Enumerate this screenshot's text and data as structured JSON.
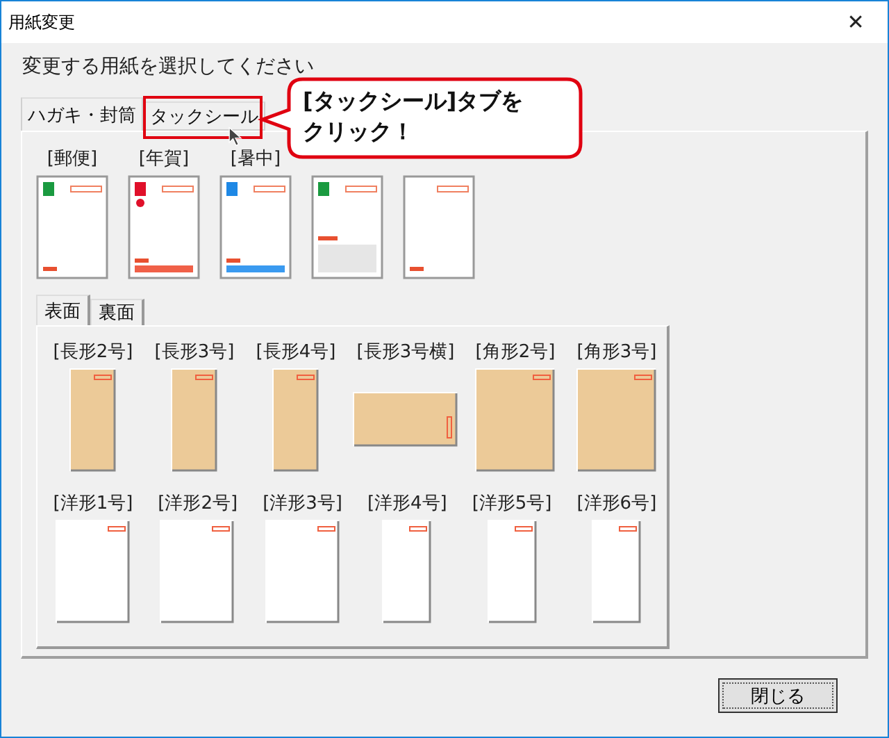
{
  "window": {
    "title": "用紙変更",
    "close": "✕"
  },
  "instruction": "変更する用紙を選択してください",
  "tabs": [
    {
      "label": "ハガキ・封筒",
      "selected": true
    },
    {
      "label": "タックシール",
      "selected": false
    }
  ],
  "postcards": [
    {
      "label": "[郵便]",
      "kind": "postal"
    },
    {
      "label": "[年賀]",
      "kind": "new_year"
    },
    {
      "label": "[暑中]",
      "kind": "summer"
    },
    {
      "kind": "greeting"
    },
    {
      "kind": "plain"
    }
  ],
  "envelope_tabs": [
    {
      "label": "表面",
      "selected": true
    },
    {
      "label": "裏面",
      "selected": false
    }
  ],
  "envelope_rows": [
    [
      {
        "label": "[長形2号]",
        "kind": "kraft_tall"
      },
      {
        "label": "[長形3号]",
        "kind": "kraft_tall"
      },
      {
        "label": "[長形4号]",
        "kind": "kraft_tall"
      },
      {
        "label": "[長形3号横]",
        "kind": "kraft_landscape"
      },
      {
        "label": "[角形2号]",
        "kind": "kraft_wide"
      },
      {
        "label": "[角形3号]",
        "kind": "kraft_wide"
      }
    ],
    [
      {
        "label": "[洋形1号]",
        "kind": "white_western"
      },
      {
        "label": "[洋形2号]",
        "kind": "white_western"
      },
      {
        "label": "[洋形3号]",
        "kind": "white_western"
      },
      {
        "label": "[洋形4号]",
        "kind": "white_narrow"
      },
      {
        "label": "[洋形5号]",
        "kind": "white_narrow"
      },
      {
        "label": "[洋形6号]",
        "kind": "white_narrow"
      }
    ]
  ],
  "close_button": "閉じる",
  "callout": {
    "lines": [
      "[タックシール]タブを",
      "クリック！"
    ]
  }
}
